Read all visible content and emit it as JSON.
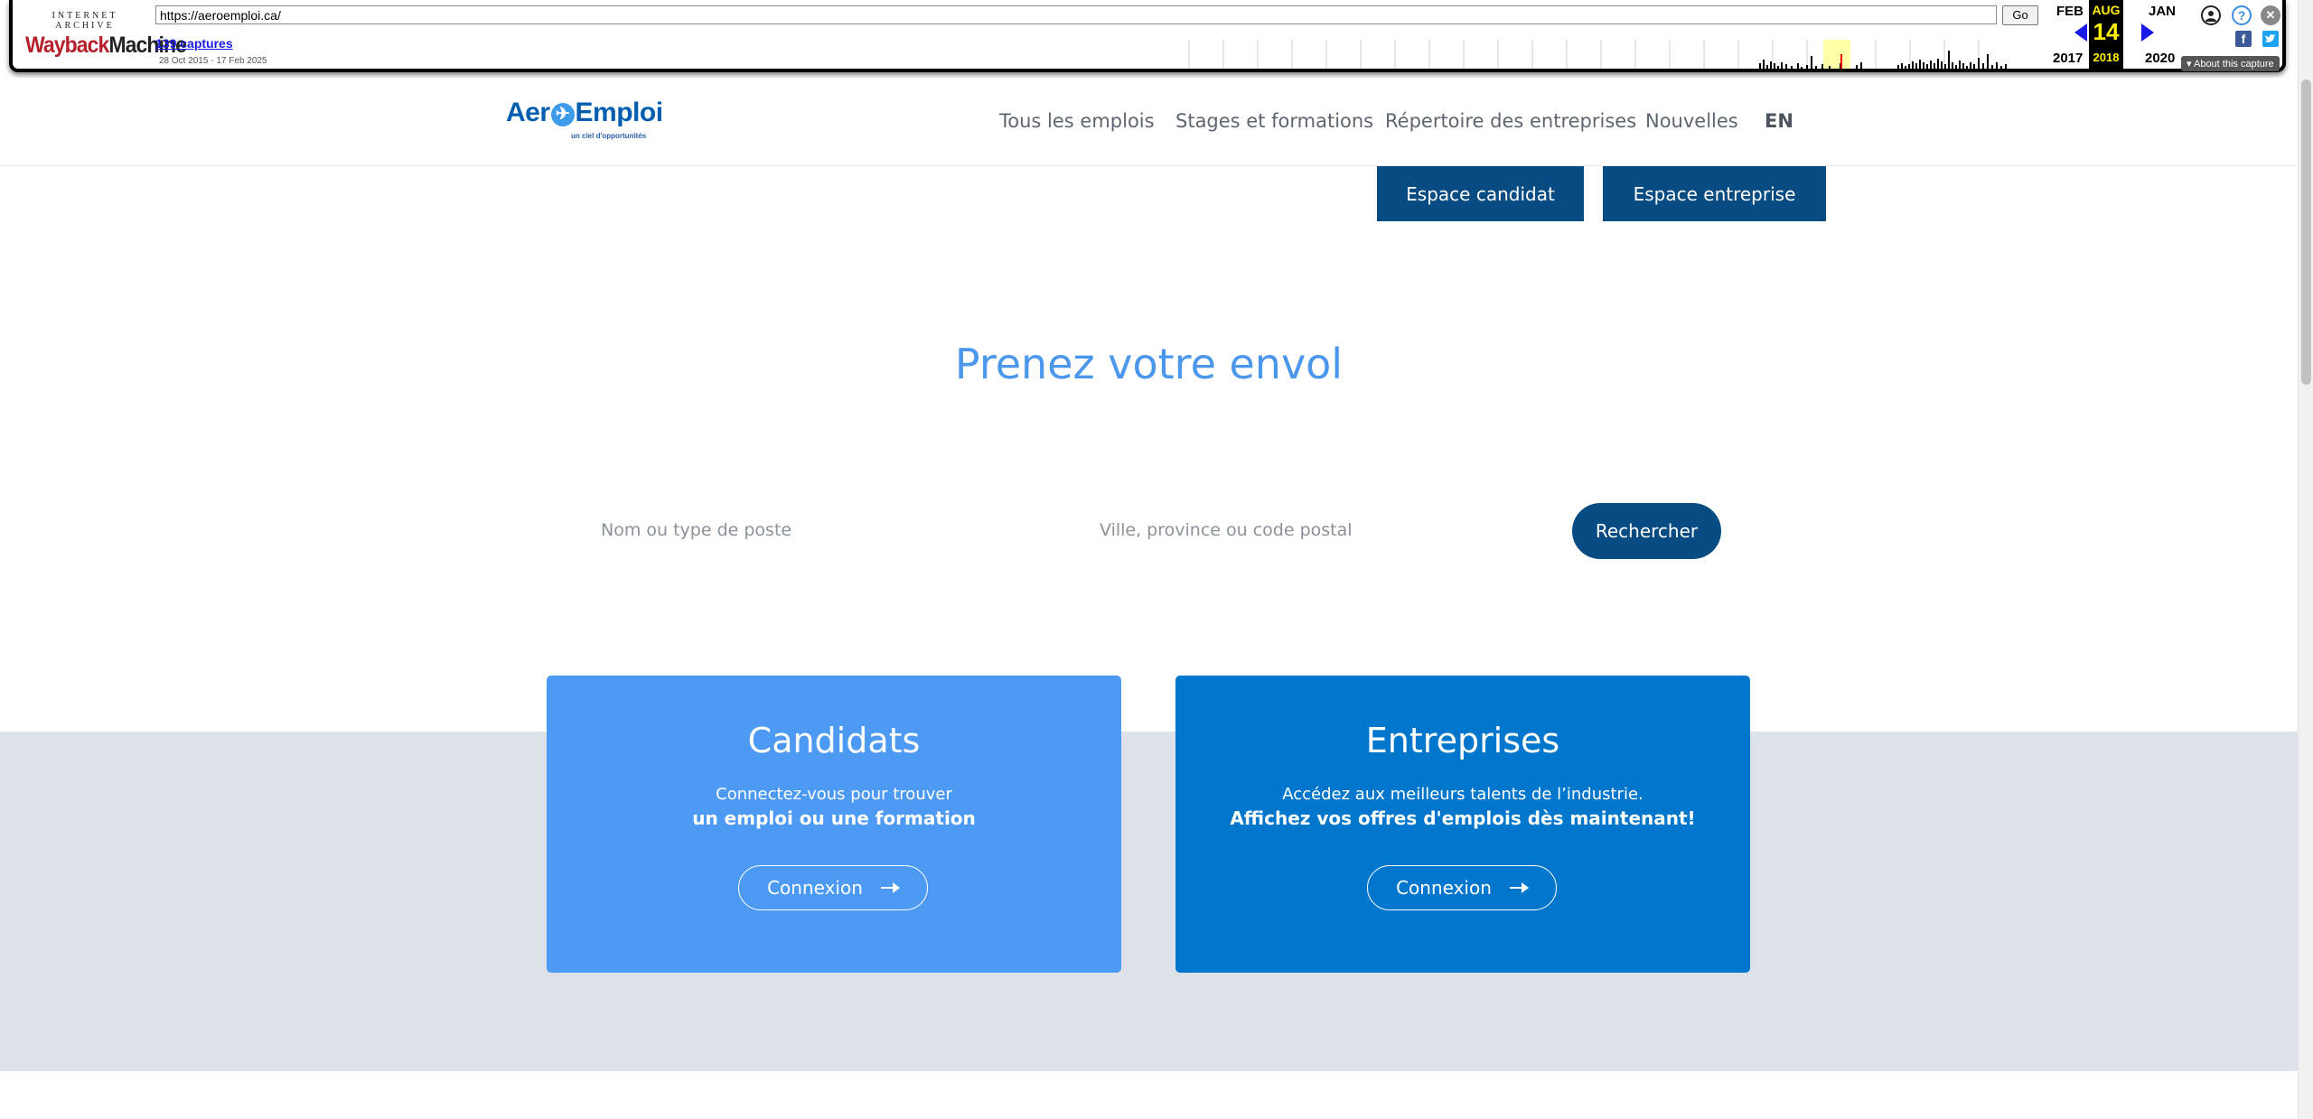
{
  "wayback": {
    "logo_top": "INTERNET ARCHIVE",
    "logo_wayback": "Wayback",
    "logo_machine": "Machine",
    "url": "https://aeroemploi.ca/",
    "go_label": "Go",
    "captures_label": "139 captures",
    "date_range": "28 Oct 2015 - 17 Feb 2025",
    "prev_month": "FEB",
    "prev_year": "2017",
    "cur_month": "AUG",
    "cur_day": "14",
    "cur_year": "2018",
    "next_month": "JAN",
    "next_year": "2020",
    "about_label": "About this capture",
    "help_label": "?",
    "close_label": "✕"
  },
  "site": {
    "logo_text_a": "Aer",
    "logo_text_o": "✈",
    "logo_text_b": "Emploi",
    "logo_tagline": "un ciel d'opportunités",
    "nav": {
      "all_jobs": "Tous les emplois",
      "internships": "Stages et formations",
      "directory": "Répertoire des entreprises",
      "news": "Nouvelles",
      "lang": "EN"
    },
    "candidate_space": "Espace candidat",
    "company_space": "Espace entreprise",
    "hero_title": "Prenez votre envol",
    "search": {
      "job_placeholder": "Nom ou type de poste",
      "location_placeholder": "Ville, province ou code postal",
      "button": "Rechercher"
    },
    "cards": {
      "candidates": {
        "title": "Candidats",
        "line1": "Connectez-vous pour trouver",
        "line2": "un emploi ou une formation",
        "button": "Connexion",
        "color": "#4d9af5"
      },
      "companies": {
        "title": "Entreprises",
        "line1": "Accédez aux meilleurs talents de l’industrie.",
        "line2": "Affichez vos offres d'emplois dès maintenant!",
        "button": "Connexion",
        "color": "#0077cc"
      }
    }
  }
}
